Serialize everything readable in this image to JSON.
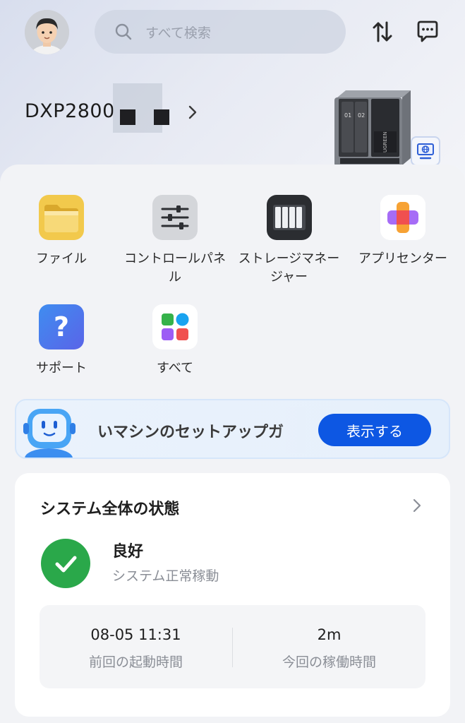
{
  "header": {
    "search_placeholder": "すべて検索",
    "device_name": "DXP2800"
  },
  "apps": [
    {
      "label": "ファイル",
      "icon": "folder-icon"
    },
    {
      "label": "コントロールパネル",
      "icon": "control-panel-icon"
    },
    {
      "label": "ストレージマネージャー",
      "icon": "storage-manager-icon"
    },
    {
      "label": "アプリセンター",
      "icon": "app-center-icon"
    },
    {
      "label": "サポート",
      "icon": "support-icon"
    },
    {
      "label": "すべて",
      "icon": "all-apps-icon"
    }
  ],
  "banner": {
    "text": "いマシンのセットアップガ",
    "button": "表示する"
  },
  "status": {
    "title": "システム全体の状態",
    "state": "良好",
    "detail": "システム正常稼動",
    "stats": [
      {
        "value": "08-05 11:31",
        "label": "前回の起動時間"
      },
      {
        "value": "2m",
        "label": "今回の稼働時間"
      }
    ]
  },
  "colors": {
    "accent": "#0d57e3",
    "ok": "#2aa84a"
  }
}
